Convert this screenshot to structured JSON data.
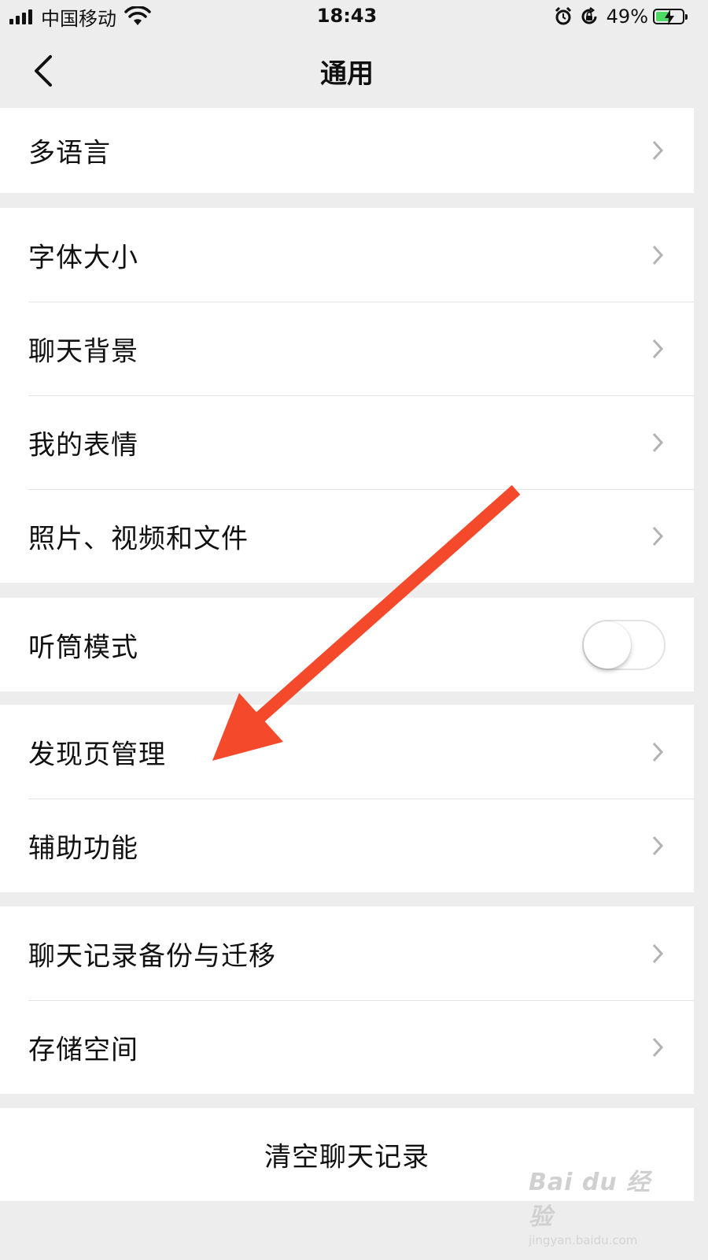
{
  "status_bar": {
    "carrier": "中国移动",
    "time": "18:43",
    "battery_percent": "49%",
    "battery_level": 0.49,
    "icons": [
      "signal-icon",
      "wifi-icon",
      "alarm-icon",
      "rotation-lock-icon",
      "battery-charging-icon"
    ]
  },
  "nav": {
    "title": "通用",
    "back_icon": "chevron-left-icon"
  },
  "groups": {
    "g1": [
      "多语言"
    ],
    "g2": [
      "字体大小",
      "聊天背景",
      "我的表情",
      "照片、视频和文件"
    ],
    "g3": {
      "label": "听筒模式",
      "toggle_on": false
    },
    "g4": [
      "发现页管理",
      "辅助功能"
    ],
    "g5": [
      "聊天记录备份与迁移",
      "存储空间"
    ],
    "clear": "清空聊天记录"
  },
  "annotation": {
    "arrow_color": "#f4492a",
    "points_to": "发现页管理"
  },
  "watermark": {
    "logo": "Bai du 经验",
    "url": "jingyan.baidu.com"
  }
}
